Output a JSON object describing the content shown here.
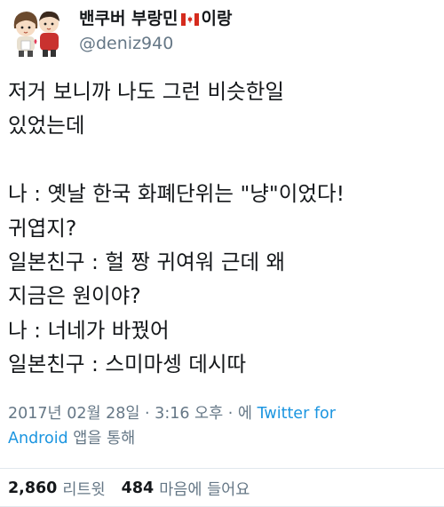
{
  "author": {
    "name_before": "밴쿠버 부랑민",
    "flag_icon": "canada-flag-icon",
    "name_after": "이랑",
    "handle": "@deniz940",
    "avatar_icon": "cartoon-couple-avatar"
  },
  "tweet": {
    "lines": [
      "저거 보니까 나도 그런 비슷한일",
      "있었는데",
      "",
      "나 : 옛날 한국 화폐단위는 \"냥\"이었다!",
      "귀엽지?",
      "일본친구 : 헐 짱 귀여워 근데 왜",
      "지금은 원이야?",
      "나 : 너네가 바꿨어",
      "일본친구 : 스미마셍 데시따"
    ],
    "meta_prefix": "2017년 02월 28일 · 3:16 오후 · 에 ",
    "meta_link_1": "Twitter for",
    "meta_link_2": "Android",
    "meta_suffix": " 앱을 통해"
  },
  "stats": {
    "retweets": "2,860",
    "retweets_label": "리트윗",
    "likes": "484",
    "likes_label": "마음에 들어요"
  },
  "colors": {
    "text": "#14171a",
    "secondary": "#657786",
    "link": "#1b95e0",
    "divider": "#e1e8ed"
  }
}
